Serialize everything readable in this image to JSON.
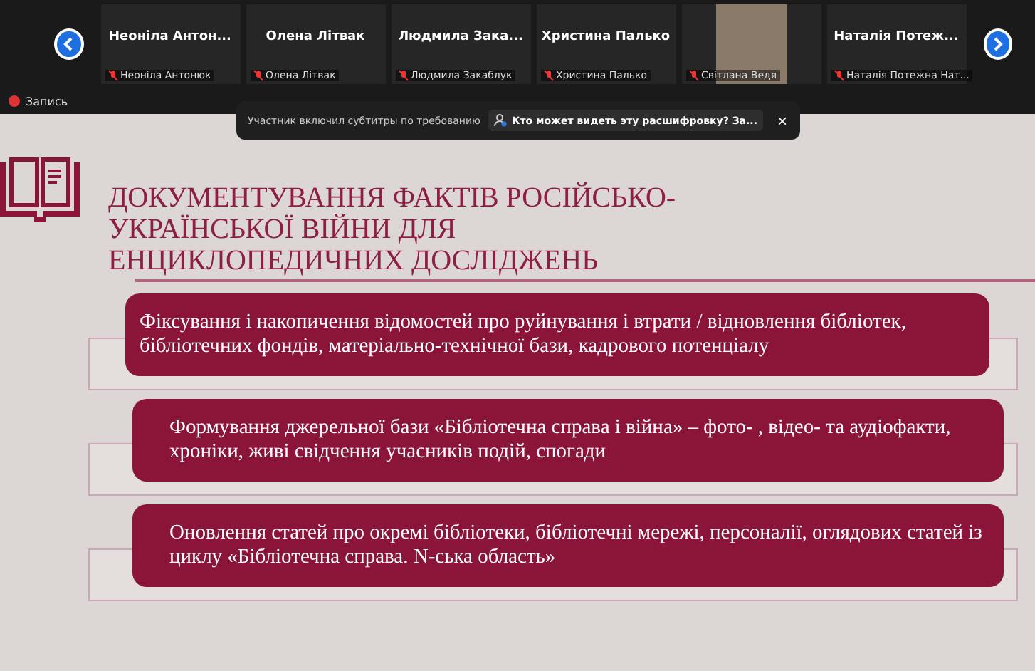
{
  "participants": [
    {
      "kind": "name",
      "name": "Неоніла Антон...",
      "label": "Неоніла Антонюк"
    },
    {
      "kind": "name",
      "name": "Олена Літвак",
      "label": "Олена Літвак"
    },
    {
      "kind": "name",
      "name": "Людмила Зака...",
      "label": "Людмила Закаблук"
    },
    {
      "kind": "name",
      "name": "Христина Палько",
      "label": "Христина Палько"
    },
    {
      "kind": "video",
      "label": "Світлана Ведя"
    },
    {
      "kind": "name",
      "name": "Наталія Потеж...",
      "label": "Наталія Потежна Нат..."
    }
  ],
  "recording": {
    "label": "Запись"
  },
  "caption_notice": {
    "text": "Участник включил субтитры по требованию",
    "link": "Кто может видеть эту расшифровку? За...",
    "close": "×"
  },
  "slide": {
    "title": "ДОКУМЕНТУВАННЯ ФАКТІВ РОСІЙСЬКО-УКРАЇНСЬКОЇ ВІЙНИ ДЛЯ ЕНЦИКЛОПЕДИЧНИХ ДОСЛІДЖЕНЬ",
    "items": [
      "Фіксування і накопичення відомостей про руйнування і втрати / відновлення бібліотек, бібліотечних фондів, матеріально-технічної бази, кадрового потенціалу",
      "Формування джерельної бази «Бібліотечна справа і війна» – фото- , відео- та аудіофакти, хроніки, живі свідчення учасників подій, спогади",
      "Оновлення статей про окремі бібліотеки, бібліотечні мережі, персоналії, оглядових статей із циклу «Бібліотечна справа. N-ська область»"
    ]
  }
}
